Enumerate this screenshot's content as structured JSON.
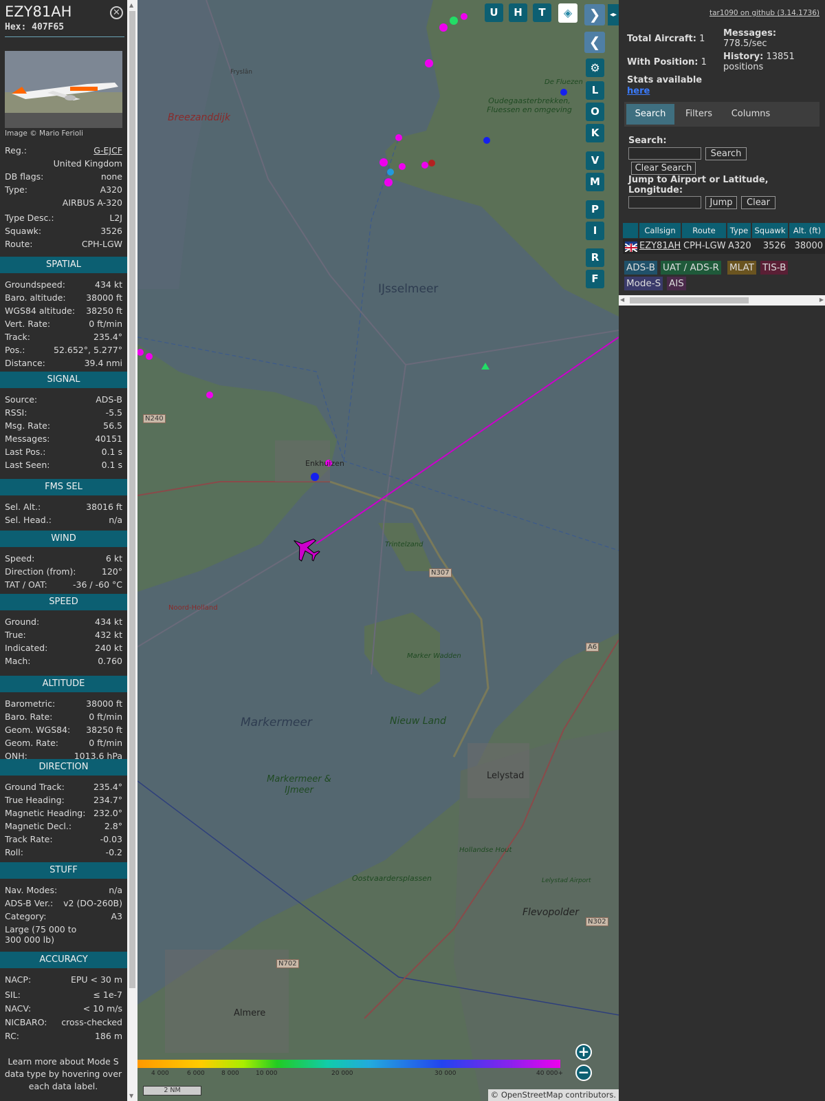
{
  "aircraft": {
    "callsign": "EZY81AH",
    "hex_label": "Hex:",
    "hex": "407F65",
    "image_credit": "Image © Mario Ferioli"
  },
  "details": [
    {
      "label": "Reg.:",
      "value": "G-EJCF",
      "link": true
    },
    {
      "label": "",
      "value": "United Kingdom"
    },
    {
      "label": "DB flags:",
      "value": "none"
    },
    {
      "label": "Type:",
      "value": "A320"
    },
    {
      "label": "",
      "value": "AIRBUS A-320"
    },
    {
      "label": "Type Desc.:",
      "value": "L2J"
    },
    {
      "label": "Squawk:",
      "value": "3526"
    },
    {
      "label": "Route:",
      "value": "CPH-LGW"
    }
  ],
  "sections": [
    {
      "title": "SPATIAL",
      "rows": [
        [
          "Groundspeed:",
          "434 kt"
        ],
        [
          "Baro. altitude:",
          "38000 ft"
        ],
        [
          "WGS84 altitude:",
          "38250 ft"
        ],
        [
          "Vert. Rate:",
          "0 ft/min"
        ],
        [
          "Track:",
          "235.4°"
        ],
        [
          "Pos.:",
          "52.652°, 5.277°"
        ],
        [
          "Distance:",
          "39.4 nmi"
        ]
      ]
    },
    {
      "title": "SIGNAL",
      "rows": [
        [
          "Source:",
          "ADS-B"
        ],
        [
          "RSSI:",
          "-5.5"
        ],
        [
          "Msg. Rate:",
          "56.5"
        ],
        [
          "Messages:",
          "40151"
        ],
        [
          "Last Pos.:",
          "0.1 s"
        ],
        [
          "Last Seen:",
          "0.1 s"
        ]
      ]
    },
    {
      "title": "FMS SEL",
      "rows": [
        [
          "Sel. Alt.:",
          "38016 ft"
        ],
        [
          "Sel. Head.:",
          "n/a"
        ]
      ]
    },
    {
      "title": "WIND",
      "rows": [
        [
          "Speed:",
          "6 kt"
        ],
        [
          "Direction (from):",
          "120°"
        ],
        [
          "TAT / OAT:",
          "-36 / -60 °C"
        ]
      ]
    },
    {
      "title": "SPEED",
      "rows": [
        [
          "Ground:",
          "434 kt"
        ],
        [
          "True:",
          "432 kt"
        ],
        [
          "Indicated:",
          "240 kt"
        ],
        [
          "Mach:",
          "0.760"
        ]
      ]
    },
    {
      "title": "ALTITUDE",
      "rows": [
        [
          "Barometric:",
          "38000 ft"
        ],
        [
          "Baro. Rate:",
          "0 ft/min"
        ],
        [
          "Geom. WGS84:",
          "38250 ft"
        ],
        [
          "Geom. Rate:",
          "0 ft/min"
        ],
        [
          "QNH:",
          "1013.6 hPa"
        ]
      ]
    },
    {
      "title": "DIRECTION",
      "rows": [
        [
          "Ground Track:",
          "235.4°"
        ],
        [
          "True Heading:",
          "234.7°"
        ],
        [
          "Magnetic Heading:",
          "232.0°"
        ],
        [
          "Magnetic Decl.:",
          "2.8°"
        ],
        [
          "Track Rate:",
          "-0.03"
        ],
        [
          "Roll:",
          "-0.2"
        ]
      ]
    },
    {
      "title": "STUFF",
      "rows": [
        [
          "Nav. Modes:",
          "n/a"
        ],
        [
          "ADS-B Ver.:",
          "v2 (DO-260B)"
        ],
        [
          "Category:",
          "A3"
        ],
        [
          "Large (75 000 to 300 000 lb)",
          ""
        ]
      ]
    },
    {
      "title": "ACCURACY",
      "rows": [
        [
          "NACP:",
          "EPU < 30 m"
        ],
        [
          "SIL:",
          "≤ 1e-7"
        ],
        [
          "NACV:",
          "< 10 m/s"
        ],
        [
          "NICBARO:",
          "cross-checked"
        ],
        [
          "RC:",
          "186 m"
        ]
      ]
    }
  ],
  "learn_more": "Learn more about Mode S data type by hovering over each data label.",
  "map": {
    "labels": [
      "Breezanddijk",
      "IJsselmeer",
      "Markermeer",
      "Markermeer & IJmeer",
      "Nieuw Land",
      "Lelystad",
      "Almere",
      "Flevopolder",
      "Oostvaardersplassen",
      "Trintelzand",
      "Marker Wadden",
      "Oudegaasterbrekken, Fluessen en omgeving",
      "De Fluezen",
      "Enkhuizen",
      "Hollandse Hout",
      "Lelystad Airport",
      "Noord-Holland",
      "Fryslân"
    ],
    "roads": [
      "N240",
      "N307",
      "N702",
      "A6",
      "N302"
    ],
    "buttons": [
      "U",
      "H",
      "T",
      "L",
      "O",
      "K",
      "V",
      "M",
      "P",
      "I",
      "R",
      "F"
    ],
    "altitude_scale": [
      "4 000",
      "6 000",
      "8 000",
      "10 000",
      "20 000",
      "30 000",
      "40 000+"
    ],
    "scale_bar": "2 NM",
    "attribution": "© OpenStreetMap contributors."
  },
  "stats": {
    "version_link": "tar1090 on github (3.14.1736)",
    "total_label": "Total Aircraft:",
    "total": "1",
    "with_pos_label": "With Position:",
    "with_pos": "1",
    "messages_label": "Messages:",
    "messages": "778.5/sec",
    "history_label": "History:",
    "history": "13851 positions",
    "stats_label": "Stats available",
    "stats_link": "here"
  },
  "tabs": [
    "Search",
    "Filters",
    "Columns"
  ],
  "search": {
    "label": "Search:",
    "button": "Search",
    "clear": "Clear Search",
    "jump_label": "Jump to Airport or Latitude, Longitude:",
    "jump": "Jump",
    "clear2": "Clear"
  },
  "table": {
    "headers": [
      "Callsign",
      "Route",
      "Type",
      "Squawk",
      "Alt. (ft)"
    ],
    "row": [
      "EZY81AH",
      "CPH-LGW",
      "A320",
      "3526",
      "38000"
    ]
  },
  "legend": [
    {
      "name": "ADS-B",
      "color": "#20516a"
    },
    {
      "name": "UAT / ADS-R",
      "color": "#1f5a3a"
    },
    {
      "name": "MLAT",
      "color": "#6a5420"
    },
    {
      "name": "TIS-B",
      "color": "#5a1f35"
    },
    {
      "name": "Mode-S",
      "color": "#3a3a6a"
    },
    {
      "name": "AIS",
      "color": "#4a2a4a"
    }
  ]
}
